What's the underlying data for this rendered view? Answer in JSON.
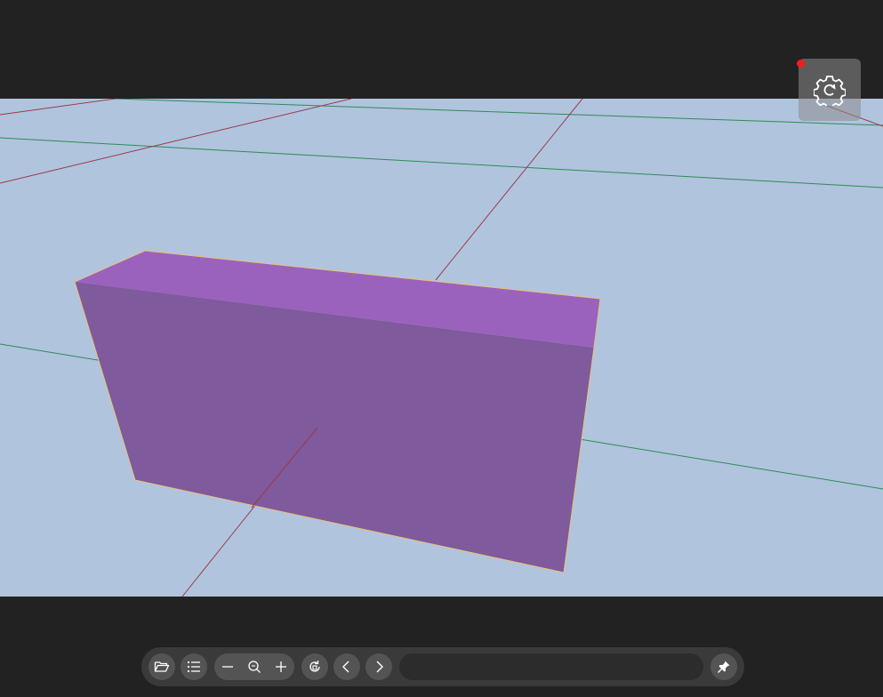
{
  "viewer": {
    "background_color": "#b0c4de",
    "box_top_color": "#9a62bd",
    "box_front_color": "#7f5a9c",
    "box_edge_color": "#e8c27a",
    "grid_x_color": "#2e8b57",
    "grid_y_color": "#9b3a4a"
  },
  "settings": {
    "icon": "gear-refresh-icon",
    "notification_dot_color": "#ff1a1a"
  },
  "toolbar": {
    "buttons": [
      {
        "name": "open-file-button",
        "icon": "folder-open-icon"
      },
      {
        "name": "list-button",
        "icon": "list-icon"
      },
      {
        "name": "zoom-out-button",
        "icon": "minus-icon"
      },
      {
        "name": "zoom-fit-button",
        "icon": "magnifier-icon"
      },
      {
        "name": "zoom-in-button",
        "icon": "plus-icon"
      },
      {
        "name": "rotate-button",
        "icon": "rotate-icon"
      },
      {
        "name": "previous-button",
        "icon": "chevron-left-icon"
      },
      {
        "name": "next-button",
        "icon": "chevron-right-icon"
      },
      {
        "name": "pin-button",
        "icon": "pin-icon"
      }
    ],
    "path_value": "",
    "path_placeholder": ""
  }
}
